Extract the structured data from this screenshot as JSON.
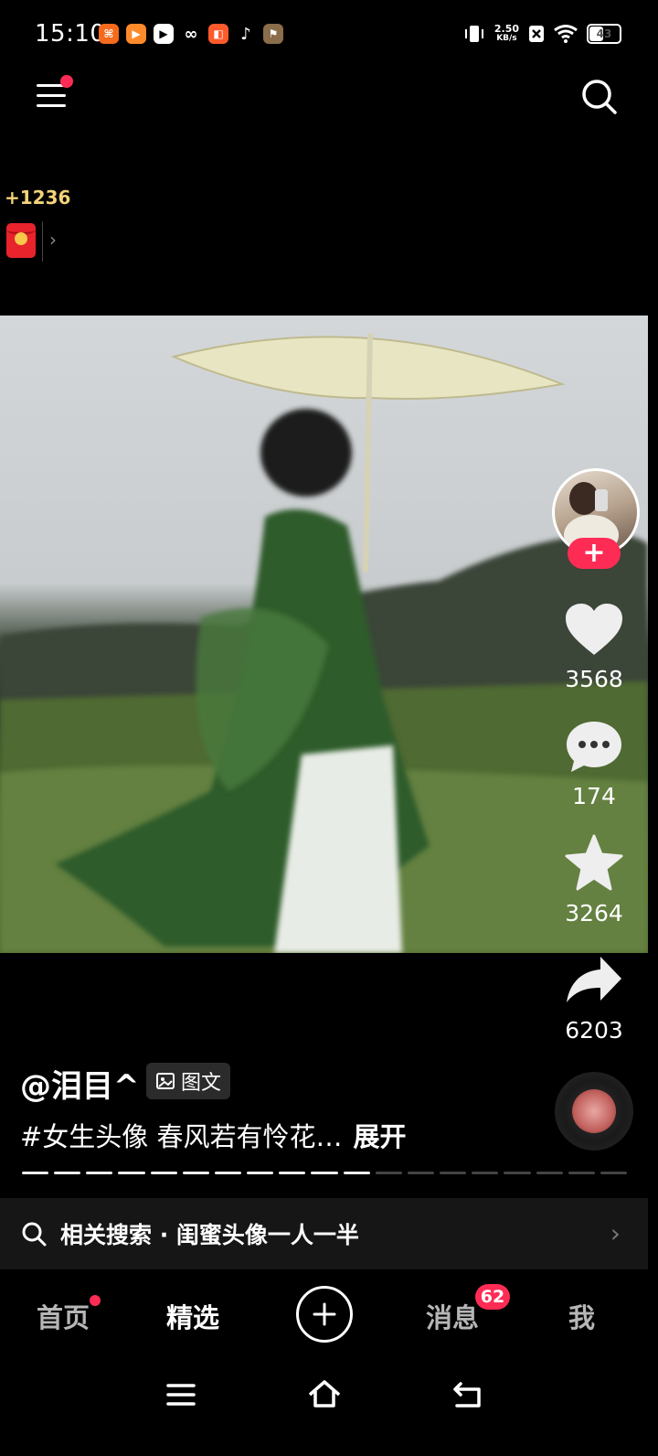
{
  "status_bar": {
    "time": "15:10",
    "net_speed_value": "2.50",
    "net_speed_unit": "KB/s",
    "battery": "43",
    "apps": [
      "app-icon-orange",
      "app-icon-video",
      "app-icon-player",
      "app-icon-link",
      "app-icon-shop",
      "tiktok-icon",
      "app-icon-game"
    ]
  },
  "top_nav": {
    "coins": "+1236"
  },
  "post": {
    "author": "@泪目^",
    "type_label": "图文",
    "caption": "#女生头像 春风若有怜花…",
    "expand_label": "展开",
    "progress_total": 19,
    "progress_done": 11
  },
  "actions": {
    "likes": "3568",
    "comments": "174",
    "favorites": "3264",
    "shares": "6203"
  },
  "related_search": {
    "text": "相关搜索 · 闺蜜头像一人一半"
  },
  "tabs": [
    {
      "label": "首页",
      "dot": true
    },
    {
      "label": "精选",
      "active": true
    },
    {
      "label": "消息",
      "badge": "62"
    },
    {
      "label": "我"
    }
  ],
  "colors": {
    "accent": "#fe2c55",
    "coin": "#f3d27a",
    "background": "#000000"
  }
}
